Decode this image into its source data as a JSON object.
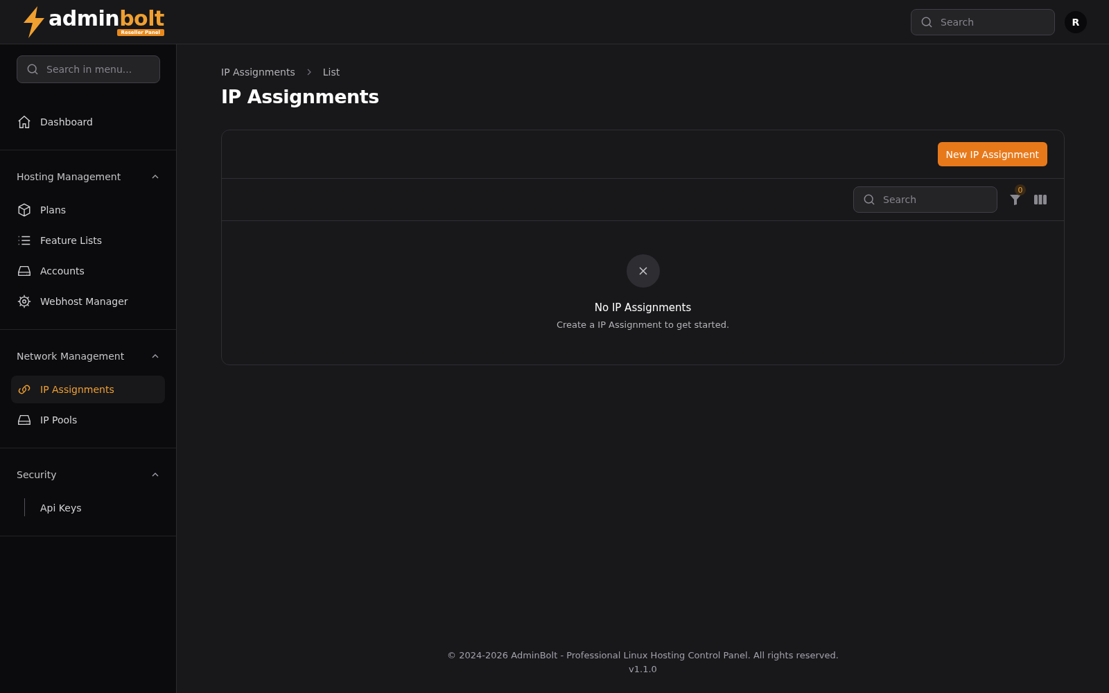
{
  "header": {
    "logo": {
      "first": "admin",
      "second": "bolt",
      "badge": "Reseller Panel"
    },
    "search": {
      "placeholder": "Search"
    },
    "avatar": "R"
  },
  "sidebar": {
    "search": {
      "placeholder": "Search in menu..."
    },
    "top_items": [
      {
        "label": "Dashboard",
        "kind": "home",
        "selected": false
      }
    ],
    "groups": [
      {
        "title": "Hosting Management",
        "expanded": true,
        "items": [
          {
            "label": "Plans",
            "kind": "cube",
            "selected": false
          },
          {
            "label": "Feature Lists",
            "kind": "list",
            "selected": false
          },
          {
            "label": "Accounts",
            "kind": "drive",
            "selected": false
          },
          {
            "label": "Webhost Manager",
            "kind": "gear",
            "selected": false
          }
        ]
      },
      {
        "title": "Network Management",
        "expanded": true,
        "items": [
          {
            "label": "IP Assignments",
            "kind": "link",
            "selected": true
          },
          {
            "label": "IP Pools",
            "kind": "drive",
            "selected": false
          }
        ]
      },
      {
        "title": "Security",
        "expanded": true,
        "items": [
          {
            "label": "Api Keys",
            "kind": "line",
            "selected": false
          }
        ]
      }
    ]
  },
  "breadcrumb": [
    "IP Assignments",
    "List"
  ],
  "page_title": "IP Assignments",
  "table": {
    "create_button": "New IP Assignment",
    "search": {
      "placeholder": "Search"
    },
    "filter_count": "0",
    "empty": {
      "title": "No IP Assignments",
      "text": "Create a IP Assignment to get started."
    }
  },
  "footer": {
    "copyright": "© 2024-2026 AdminBolt - Professional Linux Hosting Control Panel. All rights reserved.",
    "version": "v1.1.0"
  }
}
